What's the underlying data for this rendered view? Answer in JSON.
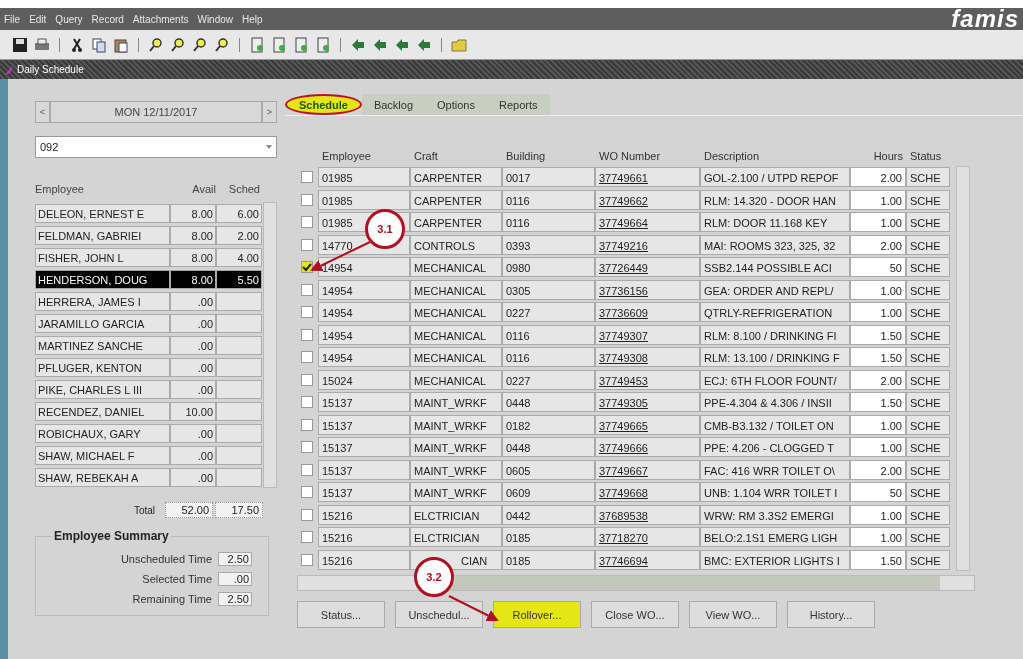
{
  "menu": [
    "File",
    "Edit",
    "Query",
    "Record",
    "Attachments",
    "Window",
    "Help"
  ],
  "logo": "famis",
  "window": {
    "title": "Daily Schedule"
  },
  "left": {
    "prev": "<",
    "date": "MON 12/11/2017",
    "next": ">",
    "shop": "092",
    "columns": [
      "Employee",
      "Avail",
      "Sched"
    ],
    "employees": [
      {
        "name": "DELEON, ERNEST E",
        "avail": "8.00",
        "sched": "6.00",
        "selected": false
      },
      {
        "name": "FELDMAN, GABRIEI",
        "avail": "8.00",
        "sched": "2.00",
        "selected": false
      },
      {
        "name": "FISHER, JOHN L",
        "avail": "8.00",
        "sched": "4.00",
        "selected": false
      },
      {
        "name": "HENDERSON, DOUG",
        "avail": "8.00",
        "sched": "5.50",
        "selected": true
      },
      {
        "name": "HERRERA, JAMES I",
        "avail": ".00",
        "selected": false
      },
      {
        "name": "JARAMILLO GARCIA",
        "avail": ".00",
        "selected": false
      },
      {
        "name": "MARTINEZ SANCHE",
        "avail": ".00",
        "selected": false
      },
      {
        "name": "PFLUGER, KENTON",
        "avail": ".00",
        "selected": false
      },
      {
        "name": "PIKE, CHARLES L III",
        "avail": ".00",
        "selected": false
      },
      {
        "name": "RECENDEZ, DANIEL",
        "avail": "10.00",
        "selected": false
      },
      {
        "name": "ROBICHAUX, GARY",
        "avail": ".00",
        "selected": false
      },
      {
        "name": "SHAW, MICHAEL F",
        "avail": ".00",
        "selected": false
      },
      {
        "name": "SHAW, REBEKAH A",
        "avail": ".00",
        "selected": false
      }
    ],
    "total_label": "Total",
    "total_avail": "52.00",
    "total_sched": "17.50",
    "summary": {
      "title": "Employee Summary",
      "rows": [
        {
          "label": "Unscheduled Time",
          "value": "2.50"
        },
        {
          "label": "Selected Time",
          "value": ".00"
        },
        {
          "label": "Remaining Time",
          "value": "2.50"
        }
      ]
    }
  },
  "tabs": [
    {
      "label": "Schedule",
      "selected": true,
      "highlighted": true
    },
    {
      "label": "Backlog",
      "selected": false,
      "highlighted": false
    },
    {
      "label": "Options",
      "selected": false,
      "highlighted": false
    },
    {
      "label": "Reports",
      "selected": false,
      "highlighted": false
    }
  ],
  "table": {
    "columns": [
      "Employee",
      "Craft",
      "Building",
      "WO Number",
      "Description",
      "Hours",
      "Status"
    ],
    "rows": [
      {
        "checked": false,
        "cells": [
          "01985",
          "CARPENTER",
          "0017",
          "37749661",
          "GOL-2.100 / UTPD REPOF",
          "2.00",
          "SCHE"
        ]
      },
      {
        "checked": false,
        "cells": [
          "01985",
          "CARPENTER",
          "0116",
          "37749662",
          "RLM: 14.320 - DOOR HAN",
          "1.00",
          "SCHE"
        ]
      },
      {
        "checked": false,
        "cells": [
          "01985",
          "CARPENTER",
          "0116",
          "37749664",
          "RLM: DOOR 11.168 KEY",
          "1.00",
          "SCHE"
        ]
      },
      {
        "checked": false,
        "cells": [
          "14770",
          "CONTROLS",
          "0393",
          "37749216",
          "MAI: ROOMS 323, 325, 32",
          "2.00",
          "SCHE"
        ]
      },
      {
        "checked": true,
        "cells": [
          "14954",
          "MECHANICAL",
          "0980",
          "37726449",
          "SSB2.144 POSSIBLE ACI",
          "50",
          "SCHE"
        ]
      },
      {
        "checked": false,
        "cells": [
          "14954",
          "MECHANICAL",
          "0305",
          "37736156",
          "GEA: ORDER AND REPL/",
          "1.00",
          "SCHE"
        ]
      },
      {
        "checked": false,
        "cells": [
          "14954",
          "MECHANICAL",
          "0227",
          "37736609",
          "QTRLY-REFRIGERATION",
          "1.00",
          "SCHE"
        ]
      },
      {
        "checked": false,
        "cells": [
          "14954",
          "MECHANICAL",
          "0116",
          "37749307",
          "RLM: 8.100 / DRINKING FI",
          "1.50",
          "SCHE"
        ]
      },
      {
        "checked": false,
        "cells": [
          "14954",
          "MECHANICAL",
          "0116",
          "37749308",
          "RLM: 13.100 / DRINKING F",
          "1.50",
          "SCHE"
        ]
      },
      {
        "checked": false,
        "cells": [
          "15024",
          "MECHANICAL",
          "0227",
          "37749453",
          "ECJ: 6TH FLOOR FOUNT/",
          "2.00",
          "SCHE"
        ]
      },
      {
        "checked": false,
        "cells": [
          "15137",
          "MAINT_WRKF",
          "0448",
          "37749305",
          "PPE-4.304 & 4.306 /  INSII",
          "1.50",
          "SCHE"
        ]
      },
      {
        "checked": false,
        "cells": [
          "15137",
          "MAINT_WRKF",
          "0182",
          "37749665",
          "CMB-B3.132 / TOILET ON",
          "1.00",
          "SCHE"
        ]
      },
      {
        "checked": false,
        "cells": [
          "15137",
          "MAINT_WRKF",
          "0448",
          "37749666",
          "PPE: 4.206 - CLOGGED T",
          "1.00",
          "SCHE"
        ]
      },
      {
        "checked": false,
        "cells": [
          "15137",
          "MAINT_WRKF",
          "0605",
          "37749667",
          "FAC: 416 WRR TOILET O\\",
          "2.00",
          "SCHE"
        ]
      },
      {
        "checked": false,
        "cells": [
          "15137",
          "MAINT_WRKF",
          "0609",
          "37749668",
          "UNB: 1.104 WRR TOILET I",
          "50",
          "SCHE"
        ]
      },
      {
        "checked": false,
        "cells": [
          "15216",
          "ELCTRICIAN",
          "0442",
          "37689538",
          "WRW: RM 3.3S2 EMERGI",
          "1.00",
          "SCHE"
        ]
      },
      {
        "checked": false,
        "cells": [
          "15216",
          "ELCTRICIAN",
          "0185",
          "37718270",
          "BELO:2.1S1 EMERG LIGH",
          "1.00",
          "SCHE"
        ]
      },
      {
        "checked": false,
        "cells": [
          "15216",
          "CIAN",
          "0185",
          "37746694",
          "BMC: EXTERIOR LIGHTS I",
          "1.50",
          "SCHE"
        ]
      }
    ]
  },
  "buttons": [
    {
      "label": "Status...",
      "highlighted": false
    },
    {
      "label": "Unschedul...",
      "highlighted": false
    },
    {
      "label": "Rollover...",
      "highlighted": true
    },
    {
      "label": "Close WO...",
      "highlighted": false
    },
    {
      "label": "View WO...",
      "highlighted": false
    },
    {
      "label": "History...",
      "highlighted": false
    }
  ],
  "callouts": [
    {
      "label": "3.1"
    },
    {
      "label": "3.2"
    }
  ]
}
